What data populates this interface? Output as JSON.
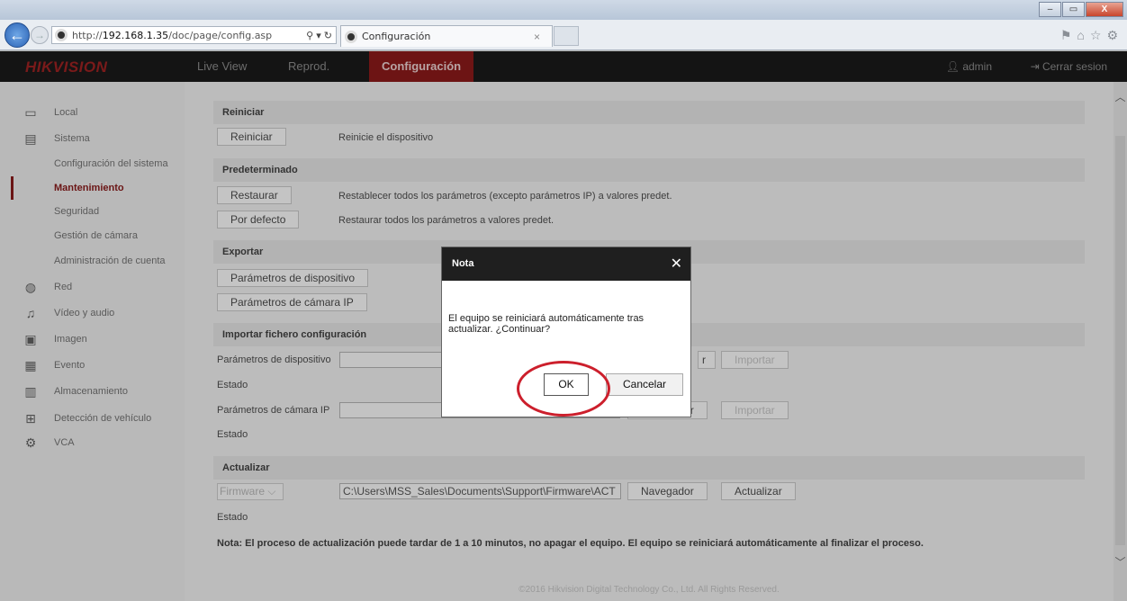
{
  "browser": {
    "url_prefix": "http://",
    "url_host": "192.168.1.35",
    "url_path": "/doc/page/config.asp",
    "url_tools": "⚲ ▾ ↻",
    "tab_title": "Configuración",
    "tab_close": "×",
    "back_glyph": "←",
    "forward_glyph": "→",
    "window_buttons": [
      "–",
      "▭",
      "X"
    ],
    "toolbar_icons": [
      "⚑",
      "⌂",
      "☆",
      "⚙"
    ]
  },
  "app": {
    "logo": "HIKVISION",
    "nav": [
      {
        "label": "Live View",
        "active": false
      },
      {
        "label": "Reprod.",
        "active": false
      },
      {
        "label": "Configuración",
        "active": true
      }
    ],
    "user": "admin",
    "logout": "Cerrar sesion",
    "accent_color": "#6d1414"
  },
  "sidebar": {
    "items": [
      {
        "label": "Local",
        "icon": "monitor-icon",
        "glyph": "▭"
      },
      {
        "label": "Sistema",
        "icon": "system-icon",
        "glyph": "▤"
      },
      {
        "label": "Configuración del sistema",
        "sub": true
      },
      {
        "label": "Mantenimiento",
        "sub": true,
        "active": true
      },
      {
        "label": "Seguridad",
        "sub": true
      },
      {
        "label": "Gestión de cámara",
        "sub": true
      },
      {
        "label": "Administración de cuenta",
        "sub": true
      },
      {
        "label": "Red",
        "icon": "globe-icon",
        "glyph": "◍"
      },
      {
        "label": "Vídeo y audio",
        "icon": "video-audio-icon",
        "glyph": "♫"
      },
      {
        "label": "Imagen",
        "icon": "image-icon",
        "glyph": "▣"
      },
      {
        "label": "Evento",
        "icon": "calendar-icon",
        "glyph": "▦"
      },
      {
        "label": "Almacenamiento",
        "icon": "storage-icon",
        "glyph": "▥"
      },
      {
        "label": "Detección de vehículo",
        "icon": "vehicle-detection-icon",
        "glyph": "⊞"
      },
      {
        "label": "VCA",
        "icon": "vca-icon",
        "glyph": "⚙"
      }
    ]
  },
  "reboot": {
    "header": "Reiniciar",
    "button": "Reiniciar",
    "desc": "Reinicie el dispositivo"
  },
  "defaults": {
    "header": "Predeterminado",
    "restore_button": "Restaurar",
    "restore_desc": "Restablecer todos los parámetros (excepto parámetros IP) a valores predet.",
    "default_button": "Por defecto",
    "default_desc": "Restaurar todos los parámetros a valores predet."
  },
  "export": {
    "header": "Exportar",
    "device_params_button": "Parámetros de dispositivo",
    "ip_camera_params_button": "Parámetros de cámara IP"
  },
  "import": {
    "header": "Importar fichero configuración",
    "device_label": "Parámetros de dispositivo",
    "device_value": "",
    "browse_button_partial": "r",
    "import_button": "Importar",
    "status_label": "Estado",
    "ip_camera_label": "Parámetros de cámara IP",
    "ip_camera_value": "",
    "browse_button": "Navegador",
    "import_button_2": "Importar",
    "status_label_2": "Estado"
  },
  "upgrade": {
    "header": "Actualizar",
    "type_select": "Firmware",
    "file_path": "C:\\Users\\MSS_Sales\\Documents\\Support\\Firmware\\ACT",
    "browse_button": "Navegador",
    "upgrade_button": "Actualizar",
    "status_label": "Estado",
    "note": "Nota: El proceso de actualización puede tardar de 1 a 10 minutos, no apagar el equipo. El equipo se reiniciará automáticamente al finalizar el proceso."
  },
  "footer": "©2016 Hikvision Digital Technology Co., Ltd. All Rights Reserved.",
  "dialog": {
    "title": "Nota",
    "close": "✕",
    "message": "El equipo se reiniciará automáticamente tras actualizar. ¿Continuar?",
    "ok": "OK",
    "cancel": "Cancelar"
  },
  "scrollbar": {
    "up": "︿",
    "down": "﹀"
  }
}
